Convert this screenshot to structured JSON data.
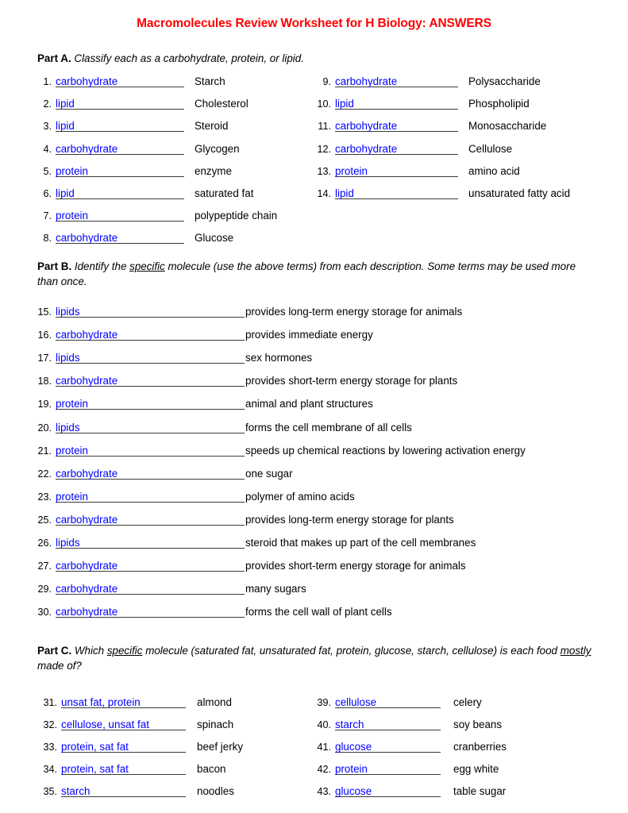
{
  "title": "Macromolecules Review Worksheet for H Biology: ANSWERS",
  "colors": {
    "title_red": "#FF0000",
    "answer_blue": "#0000FF",
    "text_black": "#000000",
    "blank_line": "#3A3A3A"
  },
  "part_a": {
    "label": "Part A.",
    "instruction_pre": " Classify each as a carbohydrate, protein, or lipid.",
    "left_items": [
      {
        "num": "1.",
        "answer": "carbohydrate",
        "desc": "Starch"
      },
      {
        "num": "2.",
        "answer": "lipid",
        "desc": "Cholesterol"
      },
      {
        "num": "3.",
        "answer": "lipid",
        "desc": "Steroid"
      },
      {
        "num": "4.",
        "answer": "carbohydrate",
        "desc": "Glycogen"
      },
      {
        "num": "5.",
        "answer": "protein",
        "desc": "enzyme"
      },
      {
        "num": "6.",
        "answer": "lipid",
        "desc": "saturated fat"
      },
      {
        "num": "7.",
        "answer": "protein",
        "desc": "polypeptide chain"
      },
      {
        "num": "8.",
        "answer": "carbohydrate",
        "desc": "Glucose"
      }
    ],
    "right_items": [
      {
        "num": "9.",
        "answer": "carbohydrate",
        "desc": "Polysaccharide"
      },
      {
        "num": "10.",
        "answer": "lipid",
        "desc": "Phospholipid"
      },
      {
        "num": "11.",
        "answer": "carbohydrate",
        "desc": "Monosaccharide"
      },
      {
        "num": "12.",
        "answer": "carbohydrate",
        "desc": "Cellulose"
      },
      {
        "num": "13.",
        "answer": "protein",
        "desc": "amino acid"
      },
      {
        "num": "14.",
        "answer": "lipid",
        "desc": "unsaturated fatty acid"
      }
    ]
  },
  "part_b": {
    "label": "Part B.",
    "instruction_1": " Identify the ",
    "instruction_underline": "specific",
    "instruction_2": " molecule (use the above terms) from each description. Some terms may be used more than once.",
    "items": [
      {
        "num": "15.",
        "answer": "lipids",
        "desc": "provides long-term energy storage for animals"
      },
      {
        "num": "16.",
        "answer": "carbohydrate",
        "desc": "provides immediate energy"
      },
      {
        "num": "17.",
        "answer": "lipids",
        "desc": "sex hormones"
      },
      {
        "num": "18.",
        "answer": "carbohydrate",
        "desc": "provides short-term energy storage for plants"
      },
      {
        "num": "19.",
        "answer": "protein",
        "desc": "animal and plant structures"
      },
      {
        "num": "20.",
        "answer": "lipids",
        "desc": "forms the cell membrane of all cells"
      },
      {
        "num": "21.",
        "answer": "protein",
        "desc": "speeds up chemical reactions by lowering activation energy"
      },
      {
        "num": "22.",
        "answer": "carbohydrate",
        "desc": "one sugar"
      },
      {
        "num": "23.",
        "answer": "protein",
        "desc": "polymer of amino acids"
      },
      {
        "num": "25.",
        "answer": "carbohydrate",
        "desc": "provides long-term energy storage for plants"
      },
      {
        "num": "26.",
        "answer": "lipids",
        "desc": "steroid that makes up part of the cell membranes"
      },
      {
        "num": "27.",
        "answer": "carbohydrate",
        "desc": "provides short-term energy storage for animals"
      },
      {
        "num": "29.",
        "answer": "carbohydrate",
        "desc": "many sugars"
      },
      {
        "num": "30.",
        "answer": "carbohydrate",
        "desc": "forms the cell wall of plant cells"
      }
    ]
  },
  "part_c": {
    "label": "Part C.",
    "instruction_1": " Which ",
    "instruction_underline_1": "specific",
    "instruction_2": " molecule (saturated fat, unsaturated fat, protein, glucose, starch, cellulose) is each food ",
    "instruction_underline_2": "mostly",
    "instruction_3": " made of?",
    "left_items": [
      {
        "num": "31.",
        "answer": "unsat fat, protein",
        "desc": "almond"
      },
      {
        "num": "32.",
        "answer": "cellulose, unsat fat",
        "desc": "spinach"
      },
      {
        "num": "33.",
        "answer": "protein, sat fat",
        "desc": "beef jerky"
      },
      {
        "num": "34.",
        "answer": "protein, sat fat",
        "desc": "bacon"
      },
      {
        "num": "35.",
        "answer": "starch",
        "desc": "noodles"
      }
    ],
    "right_items": [
      {
        "num": "39.",
        "answer": "cellulose",
        "desc": "celery"
      },
      {
        "num": "40.",
        "answer": "starch",
        "desc": "soy beans"
      },
      {
        "num": "41.",
        "answer": "glucose",
        "desc": "cranberries"
      },
      {
        "num": "42.",
        "answer": "protein",
        "desc": "egg white"
      },
      {
        "num": "43.",
        "answer": "glucose",
        "desc": "table sugar"
      }
    ]
  }
}
